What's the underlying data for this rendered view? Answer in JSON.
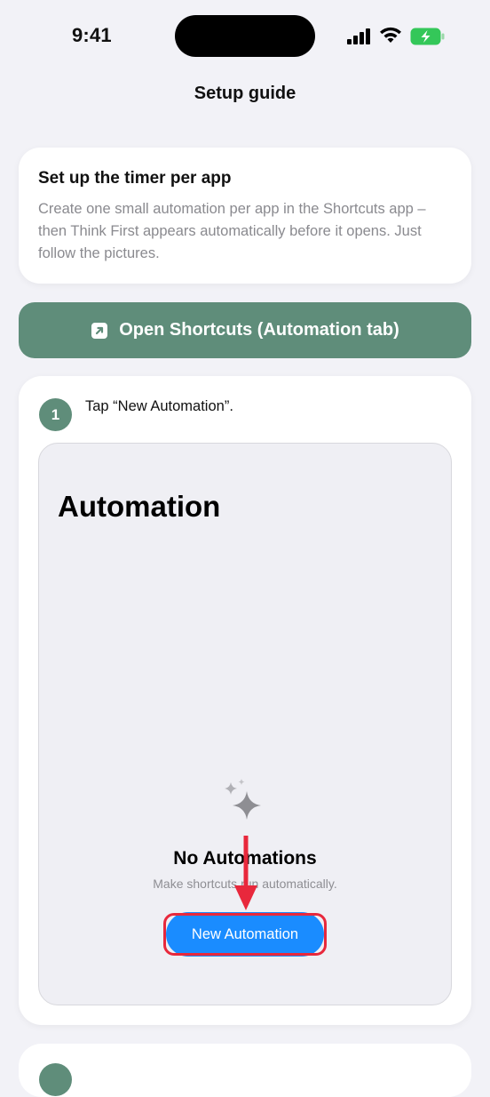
{
  "status_bar": {
    "time": "9:41"
  },
  "nav": {
    "title": "Setup guide"
  },
  "intro": {
    "title": "Set up the timer per app",
    "body": "Create one small automation per app in the Shortcuts app – then Think First appears automatically before it opens. Just follow the pictures."
  },
  "open_button": {
    "label": "Open Shortcuts (Automation tab)",
    "icon": "arrow-up-right-square-icon"
  },
  "step1": {
    "number": "1",
    "text": "Tap “New Automation”.",
    "screenshot": {
      "title": "Automation",
      "empty_title": "No Automations",
      "empty_subtitle": "Make shortcuts run automatically.",
      "button_label": "New Automation",
      "icon": "sparkles-icon"
    }
  },
  "colors": {
    "accent": "#5f8d7a",
    "highlight": "#e8283c",
    "ios_blue": "#1a8cff"
  }
}
